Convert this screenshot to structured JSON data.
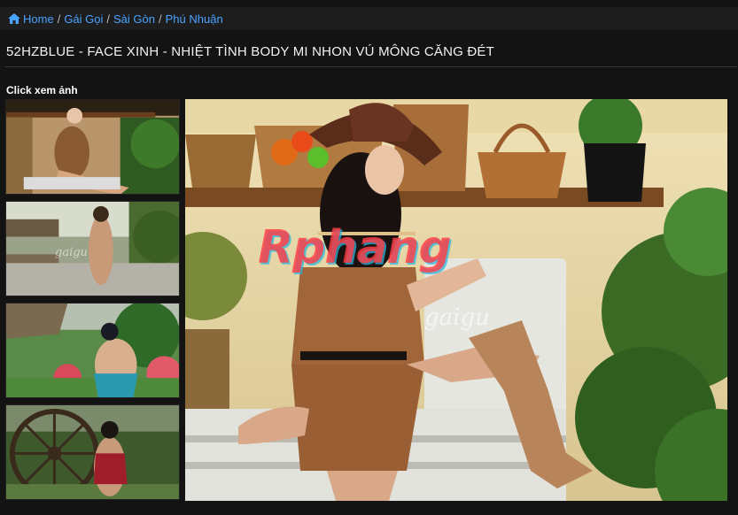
{
  "breadcrumb": {
    "items": [
      {
        "label": "Home"
      },
      {
        "label": "Gái Gọi"
      },
      {
        "label": "Sài Gòn"
      },
      {
        "label": "Phú Nhuận"
      }
    ],
    "separator": "/"
  },
  "page": {
    "title": "52HZBLUE - FACE XINH - NHIỆT TÌNH BODY MI NHON VÚ MÔNG CĂNG ĐÉT",
    "gallery_label": "Click xem ảnh"
  },
  "gallery": {
    "main_watermark": "Rphang",
    "main_watermark_sub": "gaigu",
    "thumb_watermark": "gaigu",
    "thumbnails": [
      {
        "icon": "photo-thumbnail-1"
      },
      {
        "icon": "photo-thumbnail-2"
      },
      {
        "icon": "photo-thumbnail-3"
      },
      {
        "icon": "photo-thumbnail-4"
      }
    ]
  },
  "colors": {
    "link": "#4aa3ff",
    "background": "#131313",
    "breadcrumb_bg": "#1d1d1d"
  }
}
